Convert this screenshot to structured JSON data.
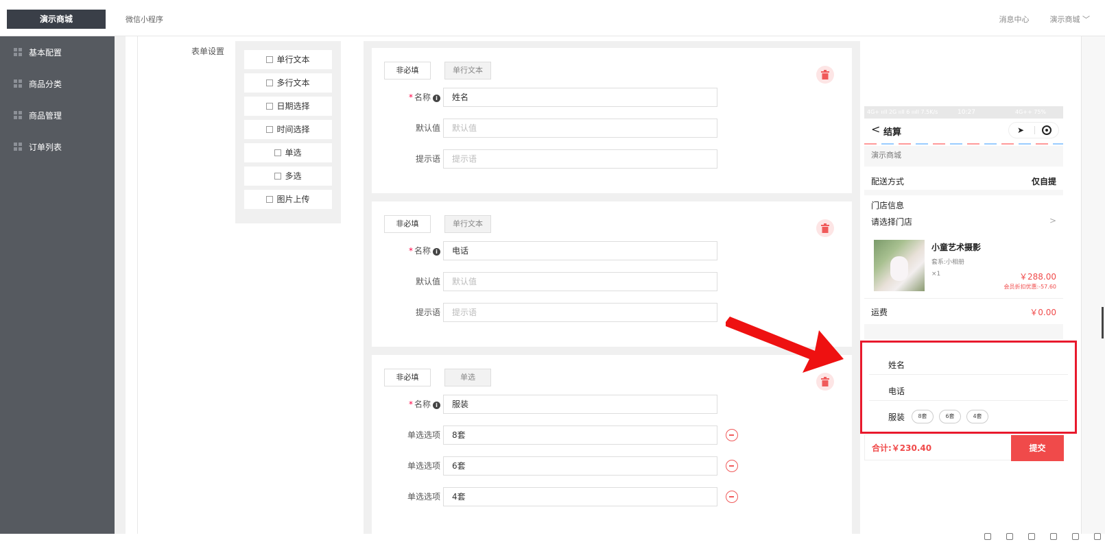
{
  "header": {
    "brand": "演示商城",
    "title": "微信小程序",
    "messages": "消息中心",
    "account": "演示商城",
    "account_chevron": "﹀"
  },
  "sidebar": {
    "items": [
      {
        "label": "基本配置",
        "icon": "grid-icon"
      },
      {
        "label": "商品分类",
        "icon": "grid-icon"
      },
      {
        "label": "商品管理",
        "icon": "grid-icon"
      },
      {
        "label": "订单列表",
        "icon": "grid-icon"
      }
    ]
  },
  "form_settings": {
    "label": "表单设置",
    "palette": [
      "单行文本",
      "多行文本",
      "日期选择",
      "时间选择",
      "单选",
      "多选",
      "图片上传"
    ]
  },
  "cards": [
    {
      "optional": "非必填",
      "type": "单行文本",
      "name_label": "名称",
      "name_value": "姓名",
      "default_label": "默认值",
      "default_placeholder": "默认值",
      "hint_label": "提示语",
      "hint_placeholder": "提示语"
    },
    {
      "optional": "非必填",
      "type": "单行文本",
      "name_label": "名称",
      "name_value": "电话",
      "default_label": "默认值",
      "default_placeholder": "默认值",
      "hint_label": "提示语",
      "hint_placeholder": "提示语"
    },
    {
      "optional": "非必填",
      "type": "单选",
      "name_label": "名称",
      "name_value": "服装",
      "option_label": "单选选项",
      "options": [
        "8套",
        "6套",
        "4套"
      ]
    }
  ],
  "required_mark": "*",
  "info_mark": "i",
  "phone": {
    "status_left": "4G+ ııll 2G ııll 6 ıııll 7.5K/s",
    "status_time": "10:27",
    "status_right": "4G++ 75%",
    "back": "<",
    "title": "结算",
    "shop": "演示商城",
    "delivery_label": "配送方式",
    "delivery_value": "仅自提",
    "store_label": "门店信息",
    "store_select": "请选择门店",
    "store_chevron": ">",
    "product_name": "小童艺术摄影",
    "product_spec": "套系:小相册",
    "product_qty": "×1",
    "product_price": "￥288.00",
    "product_discount": "会员折扣优惠:-57.60",
    "freight_label": "运费",
    "freight_value": "￥0.00",
    "form_items": [
      "姓名",
      "电话",
      "服装"
    ],
    "chips": [
      "8套",
      "6套",
      "4套"
    ],
    "total": "合计:￥230.40",
    "submit": "提交"
  },
  "colors": {
    "sidebar": "#565a60",
    "brand_bg": "#3a3f48",
    "accent_red": "#f04a4a",
    "highlight_box": "#e8192c"
  }
}
